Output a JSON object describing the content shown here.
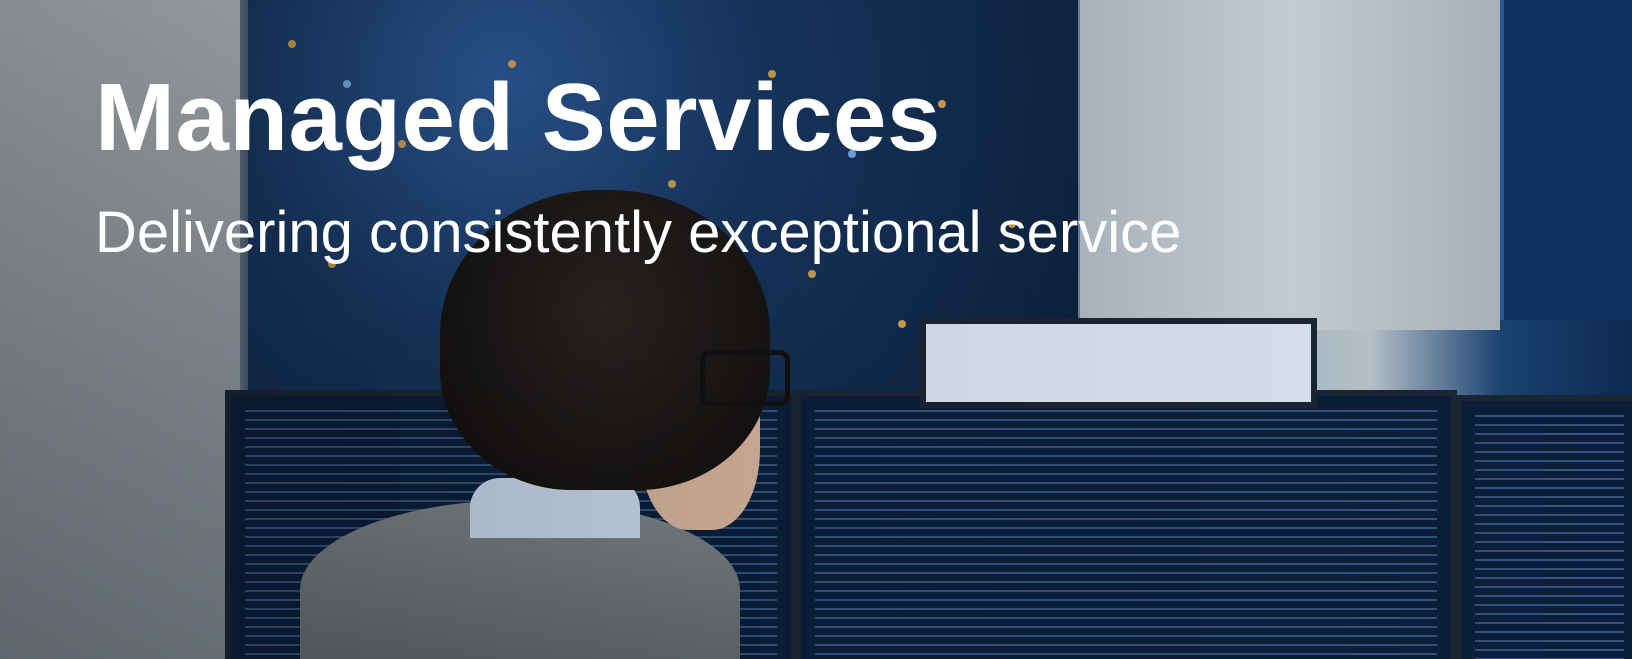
{
  "hero": {
    "title": "Managed Services",
    "subtitle": "Delivering consistently exceptional service"
  }
}
